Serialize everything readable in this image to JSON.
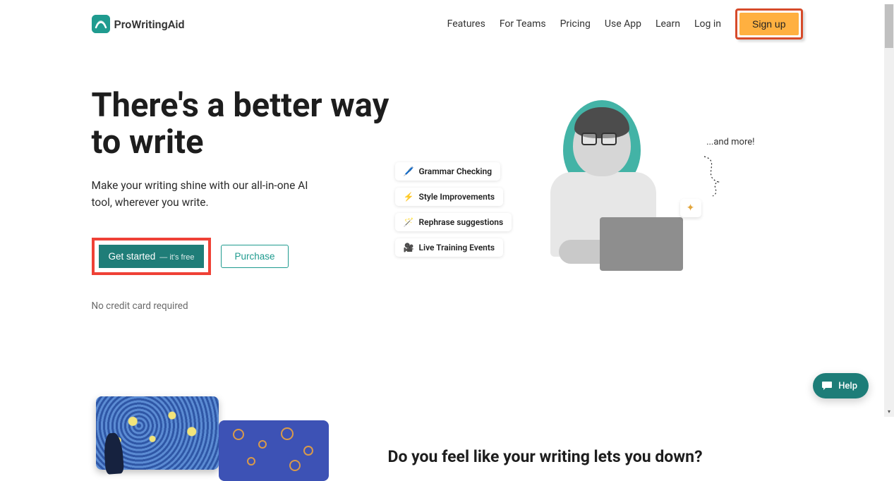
{
  "brand": {
    "name": "ProWritingAid"
  },
  "nav": {
    "features": "Features",
    "for_teams": "For Teams",
    "pricing": "Pricing",
    "use_app": "Use App",
    "learn": "Learn",
    "log_in": "Log in",
    "sign_up": "Sign up"
  },
  "hero": {
    "title": "There's a better way to write",
    "subtitle": "Make your writing shine with our all-in-one AI tool, wherever you write.",
    "get_started_label": "Get started",
    "get_started_hint": "— it's free",
    "purchase_label": "Purchase",
    "no_cc": "No credit card required",
    "and_more": "...and more!",
    "spark": "✦",
    "pills": [
      {
        "icon": "🖊️",
        "label": "Grammar Checking"
      },
      {
        "icon": "⚡",
        "label": "Style Improvements"
      },
      {
        "icon": "🪄",
        "label": "Rephrase suggestions"
      },
      {
        "icon": "🎥",
        "label": "Live Training Events"
      }
    ]
  },
  "section2": {
    "title": "Do you feel like your writing lets you down?"
  },
  "help": {
    "label": "Help"
  },
  "highlights": {
    "signup_color": "#d64b2a",
    "getstarted_color": "#ef4136"
  }
}
